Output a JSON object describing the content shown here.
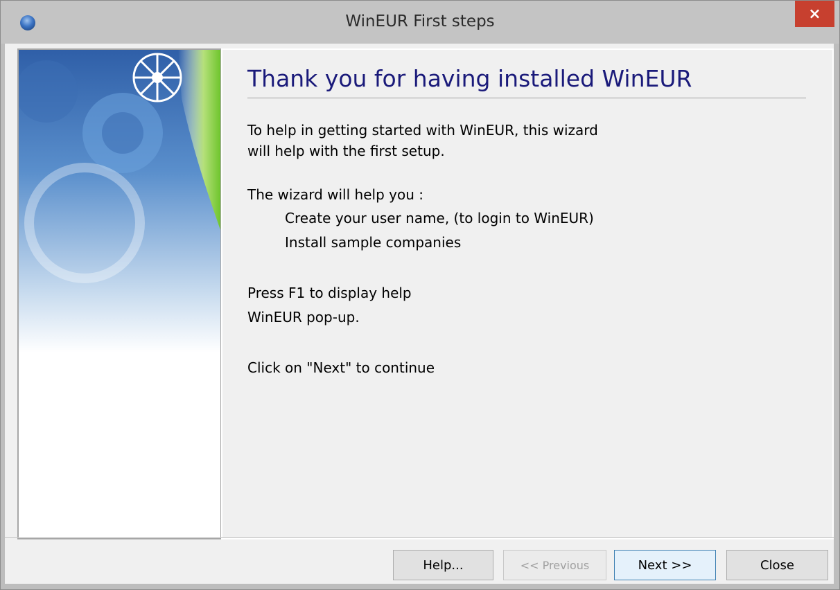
{
  "window": {
    "title": "WinEUR First steps",
    "close_symbol": "×"
  },
  "content": {
    "title": "Thank you for having installed WinEUR",
    "lines": [
      "To help in getting started with WinEUR, this wizard",
      "will help with the first setup.",
      "The wizard will help you :",
      "Create your user name, (to login to WinEUR)",
      "Install sample companies",
      "Press F1 to display help",
      "WinEUR pop-up.",
      "Click on \"Next\" to continue"
    ]
  },
  "buttons": {
    "help": "Help...",
    "previous": "<< Previous",
    "next": "Next >>",
    "close": "Close"
  },
  "icons": {
    "app": "app-globe-icon",
    "close": "close-icon",
    "side_image": "gears-banner-image"
  },
  "colors": {
    "title_text": "#1a1a7a",
    "close_button": "#c7402f"
  }
}
